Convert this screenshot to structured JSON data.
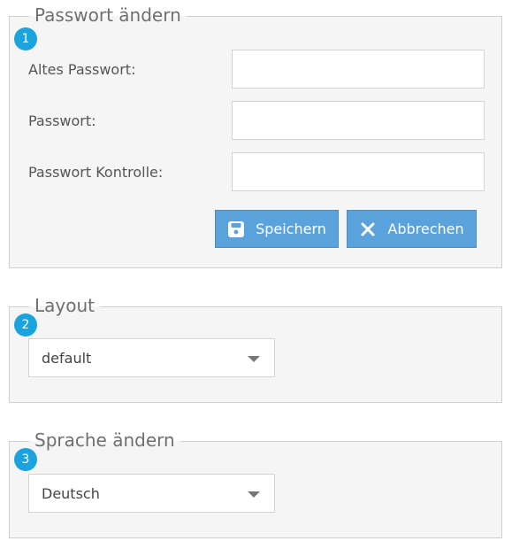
{
  "password_section": {
    "legend": "Passwort ändern",
    "badge": "1",
    "fields": [
      {
        "label": "Altes Passwort:",
        "value": ""
      },
      {
        "label": "Passwort:",
        "value": ""
      },
      {
        "label": "Passwort Kontrolle:",
        "value": ""
      }
    ],
    "save_label": "Speichern",
    "cancel_label": "Abbrechen"
  },
  "layout_section": {
    "legend": "Layout",
    "badge": "2",
    "selected": "default"
  },
  "language_section": {
    "legend": "Sprache ändern",
    "badge": "3",
    "selected": "Deutsch"
  },
  "colors": {
    "badge": "#1aa3dc",
    "button": "#5aa2db",
    "section_bg": "#f5f5f5"
  },
  "icons": {
    "save": "floppy-disk-icon",
    "cancel": "close-icon",
    "dropdown": "caret-down-icon"
  }
}
